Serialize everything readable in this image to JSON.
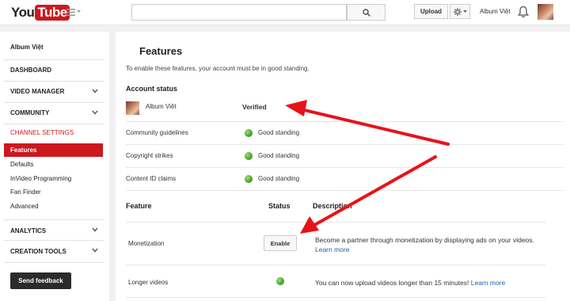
{
  "header": {
    "logo_you": "You",
    "logo_tube": "Tube",
    "search_placeholder": "",
    "upload_label": "Upload",
    "user_name": "Album Việt"
  },
  "sidebar": {
    "title": "Album Việt",
    "dashboard": "DASHBOARD",
    "video_manager": "VIDEO MANAGER",
    "community": "COMMUNITY",
    "channel_settings": "CHANNEL SETTINGS",
    "sub_items": [
      "Features",
      "Defaults",
      "InVideo Programming",
      "Fan Finder",
      "Advanced"
    ],
    "analytics": "ANALYTICS",
    "creation_tools": "CREATION TOOLS",
    "feedback": "Send feedback"
  },
  "main": {
    "title": "Features",
    "intro": "To enable these features, your account must be in good standing.",
    "account_status_heading": "Account status",
    "account_name": "Album Việt",
    "verified": "Verified",
    "status_rows": [
      {
        "label": "Community guidelines",
        "value": "Good standing"
      },
      {
        "label": "Copyright strikes",
        "value": "Good standing"
      },
      {
        "label": "Content ID claims",
        "value": "Good standing"
      }
    ],
    "feature_headers": {
      "feature": "Feature",
      "status": "Status",
      "description": "Description"
    },
    "features": [
      {
        "name": "Monetization",
        "button": "Enable",
        "desc": "Become a partner through monetization by displaying ads on your videos.",
        "link": "Learn more"
      },
      {
        "name": "Longer videos",
        "desc": "You can now upload videos longer than 15 minutes!",
        "link": "Learn more"
      }
    ]
  },
  "colors": {
    "accent": "#cc181e",
    "link": "#1b5fb3",
    "good": "#4fa62f",
    "arrow": "#e8121a"
  }
}
